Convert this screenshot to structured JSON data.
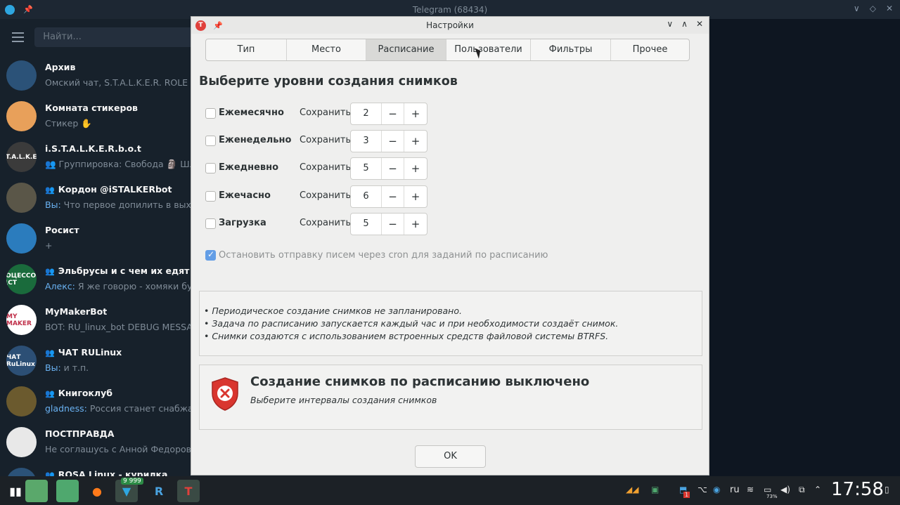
{
  "telegram": {
    "window_title": "Telegram (68434)",
    "search_placeholder": "Найти...",
    "chats": [
      {
        "name": "Архив",
        "preview": "Омский чат, S.T.A.L.K.E.R. ROLE PLAY",
        "preview_sender": "",
        "icon": "archive-icon",
        "color": "#2b5278",
        "group": false
      },
      {
        "name": "Комната стикеров",
        "preview": "Стикер ✋",
        "preview_sender": "",
        "icon": "cat-avatar",
        "color": "#e8a05a",
        "group": false
      },
      {
        "name": "i.S.T.A.L.K.E.R.b.o.t",
        "preview": "👥 Группировка: Свобода 🗿 Шле",
        "preview_sender": "",
        "icon": "bot-icon",
        "color": "#3b3b3b",
        "group": false
      },
      {
        "name": "Кордон @iSTALKERbot",
        "preview": "Что первое допилить в выходн",
        "preview_sender": "Вы:",
        "icon": "group-icon",
        "color": "#5a5648",
        "group": true
      },
      {
        "name": "Росист",
        "preview": "+",
        "preview_sender": "",
        "icon": "bot-icon",
        "color": "#2b7cbd",
        "group": false
      },
      {
        "name": "Эльбрусы и с чем их едят",
        "preview": "Я же говорю - хомяки будут",
        "preview_sender": "Алекс:",
        "icon": "group-icon",
        "color": "#1a6b3c",
        "group": true
      },
      {
        "name": "MyMakerBot",
        "preview": "BOT: RU_linux_bot DEBUG MESSAGE",
        "preview_sender": "",
        "icon": "bot-icon",
        "color": "#ffffff",
        "group": false
      },
      {
        "name": "ЧАТ RULinux",
        "preview": "и т.п.",
        "preview_sender": "Вы:",
        "icon": "group-icon",
        "color": "#2c4f75",
        "group": true
      },
      {
        "name": "Книгоклуб",
        "preview": "Россия станет снабжать И",
        "preview_sender": "gladness:",
        "icon": "group-icon",
        "color": "#6b5a2e",
        "group": true
      },
      {
        "name": "ПОСТПРАВДА",
        "preview": "Не соглашусь с Анной Федоровой,",
        "preview_sender": "",
        "icon": "megaphone-icon",
        "color": "#e8e8e8",
        "group": false
      },
      {
        "name": "ROSA Linux - курилка",
        "preview": "",
        "preview_sender": "",
        "icon": "group-icon",
        "color": "#2b5278",
        "group": true
      }
    ],
    "avatar_texts": [
      "",
      "",
      "S.T.A.L.K.E.R",
      "",
      "",
      "ПРОЦЕССОРЫ МЦСТ",
      "MY MAKER",
      "ЧАТ RuLinux",
      "",
      "",
      ""
    ]
  },
  "dialog": {
    "title": "Настройки",
    "tabs": [
      "Тип",
      "Место",
      "Расписание",
      "Пользователи",
      "Фильтры",
      "Прочее"
    ],
    "active_tab": "Расписание",
    "heading": "Выберите уровни создания снимков",
    "save_label": "Сохранить",
    "levels": [
      {
        "label": "Ежемесячно",
        "value": "2",
        "checked": false
      },
      {
        "label": "Еженедельно",
        "value": "3",
        "checked": false
      },
      {
        "label": "Ежедневно",
        "value": "5",
        "checked": false
      },
      {
        "label": "Ежечасно",
        "value": "6",
        "checked": false
      },
      {
        "label": "Загрузка",
        "value": "5",
        "checked": false
      }
    ],
    "minus": "−",
    "plus": "+",
    "cron_label": "Остановить отправку писем через cron для заданий по расписанию",
    "cron_checked": true,
    "info_lines": [
      "• Периодическое создание снимков не запланировано.",
      "• Задача по расписанию запускается каждый час и при необходимости создаёт снимок.",
      "• Снимки создаются с использованием встроенных средств файловой системы BTRFS."
    ],
    "status_title": "Создание снимков по расписанию выключено",
    "status_subtitle": "Выберите интервалы создания снимков",
    "ok_label": "OK"
  },
  "taskbar": {
    "badge": "9 999",
    "battery": "73%",
    "layout": "ru",
    "notification_count": "1",
    "clock": "17:58"
  },
  "colors": {
    "accent": "#3584e4",
    "error": "#e0403b",
    "telegram_bg": "#17212b"
  }
}
